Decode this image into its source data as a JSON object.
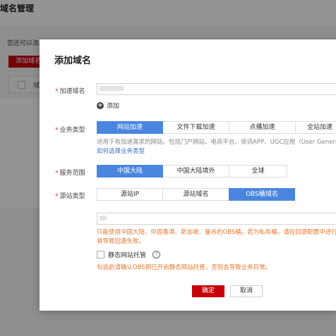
{
  "background": {
    "page_title": "域名管理",
    "info_text": "您还可以添加",
    "add_button": "添加域名",
    "column_label": "域"
  },
  "dialog": {
    "title": "添加域名",
    "domain": {
      "label": "加速域名",
      "value": "",
      "add_label": "添加"
    },
    "business_type": {
      "label": "业务类型",
      "options": [
        "网站加速",
        "文件下载加速",
        "点播加速",
        "全站加速"
      ],
      "selected": "网站加速",
      "description": "适用于有加速需求的网站，包括门户网站、电商平台、资讯APP、UGC应用（User Generated Content）等。",
      "link": "如何选择业务类型"
    },
    "service_area": {
      "label": "服务范围",
      "options": [
        "中国大陆",
        "中国大陆境外",
        "全球"
      ],
      "selected": "中国大陆"
    },
    "origin_type": {
      "label": "源站类型",
      "options": [
        "源站IP",
        "源站域名",
        "OBS桶域名"
      ],
      "selected": "OBS桶域名",
      "value": "",
      "warning": "只能使用中国大陆、中国香港、新加坡、曼谷的OBS桶，若为私有桶，请在回源配置中进行私有桶回源设置，否则将导致回源失败。",
      "warning_line2": "将导致回源失败。"
    },
    "static_hosting": {
      "label": "静态网站托管",
      "checked": false,
      "warning": "勾选前请确认OBS侧已开启静态网站托管，否则会导致业务异常。"
    },
    "confirm_label": "确定",
    "cancel_label": "取消"
  },
  "colors": {
    "primary_red": "#c7000b",
    "active_blue": "#4a86e0",
    "warning_orange": "#e8782e",
    "link_blue": "#3b6fc9"
  }
}
